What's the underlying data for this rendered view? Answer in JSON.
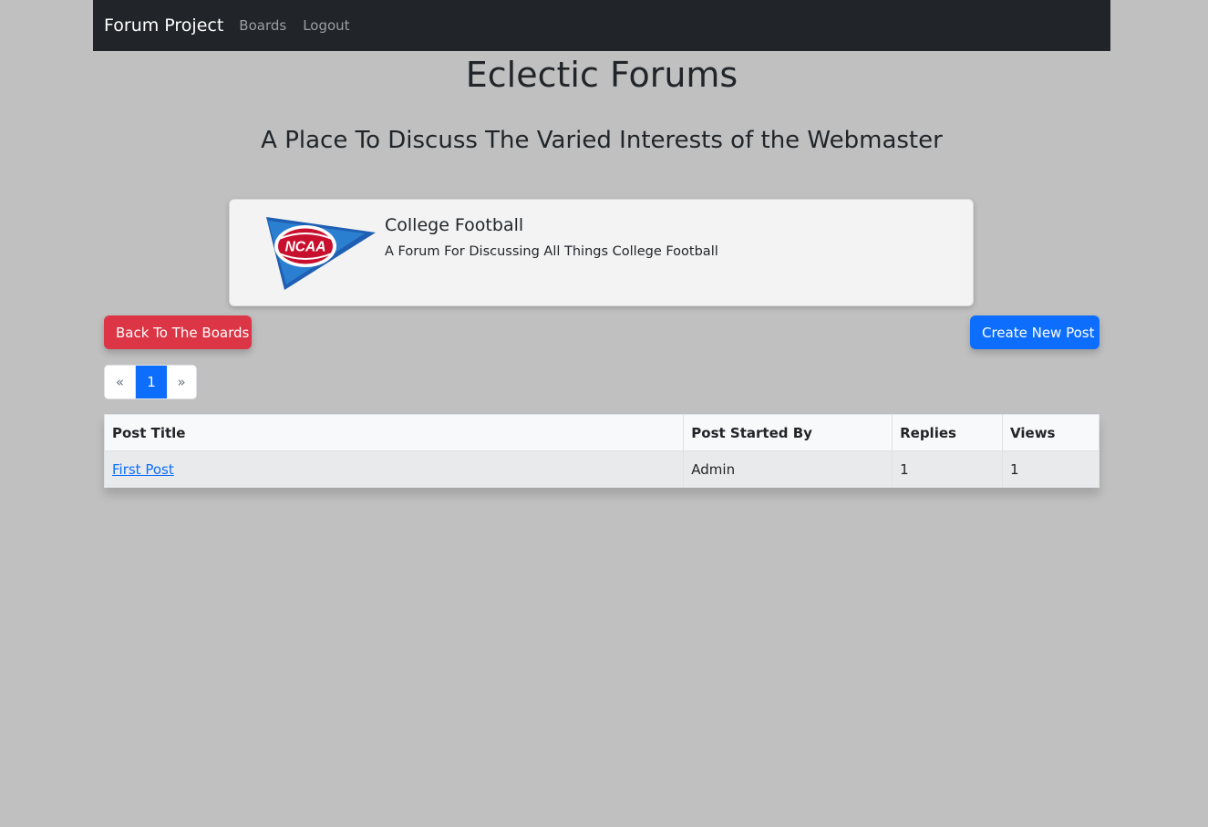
{
  "navbar": {
    "brand": "Forum Project",
    "links": [
      "Boards",
      "Logout"
    ]
  },
  "header": {
    "title": "Eclectic Forums",
    "subtitle": "A Place To Discuss The Varied Interests of the Webmaster"
  },
  "board": {
    "logo_text": "NCAA",
    "name": "College Football",
    "description": "A Forum For Discussing All Things College Football"
  },
  "actions": {
    "back_label": "Back To The Boards",
    "create_label": "Create New Post",
    "back_color": "#dc3545",
    "create_color": "#0d6efd"
  },
  "pagination": {
    "prev": "«",
    "current": "1",
    "next": "»"
  },
  "table": {
    "headers": [
      "Post Title",
      "Post Started By",
      "Replies",
      "Views"
    ],
    "rows": [
      {
        "title": "First Post",
        "author": "Admin",
        "replies": "1",
        "views": "1"
      }
    ]
  }
}
